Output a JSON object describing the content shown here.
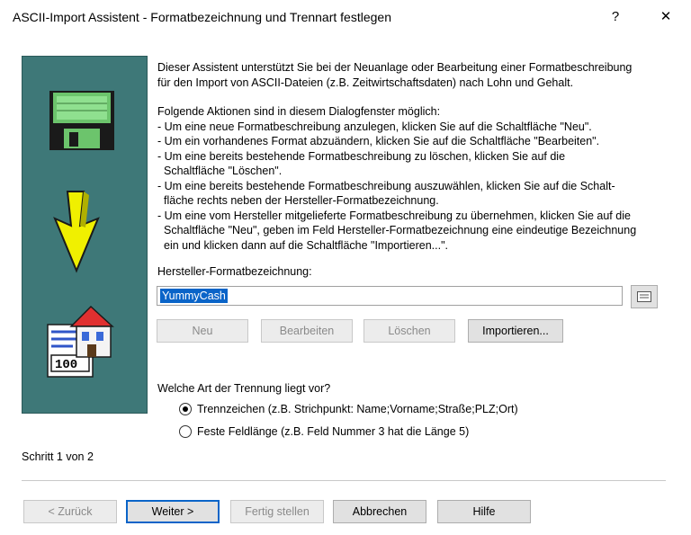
{
  "window": {
    "title": "ASCII-Import Assistent - Formatbezeichnung und Trennart festlegen",
    "help_button": "?",
    "close_button": "✕"
  },
  "description": {
    "intro_lines": [
      "Dieser Assistent unterstützt Sie bei der Neuanlage oder Bearbeitung einer Formatbeschreibung",
      "für den Import von ASCII-Dateien (z.B. Zeitwirtschaftsdaten) nach Lohn und Gehalt."
    ],
    "action_lines": [
      "Folgende Aktionen sind in diesem Dialogfenster möglich:",
      "- Um eine neue Formatbeschreibung anzulegen, klicken Sie auf die Schaltfläche \"Neu\".",
      "- Um ein vorhandenes Format abzuändern, klicken Sie auf die Schaltfläche \"Bearbeiten\".",
      "- Um eine bereits bestehende Formatbeschreibung zu löschen, klicken Sie auf die",
      "  Schaltfläche \"Löschen\".",
      "- Um eine bereits bestehende Formatbeschreibung auszuwählen, klicken Sie auf die Schalt-",
      "  fläche rechts neben der Hersteller-Formatbezeichnung.",
      "- Um eine vom Hersteller mitgelieferte Formatbeschreibung zu übernehmen, klicken Sie auf die",
      "  Schaltfläche \"Neu\", geben im Feld Hersteller-Formatbezeichnung eine eindeutige Bezeichnung",
      "  ein und klicken dann auf die Schaltfläche \"Importieren...\"."
    ]
  },
  "format_field": {
    "label": "Hersteller-Formatbezeichnung:",
    "value": "YummyCash"
  },
  "action_buttons": {
    "neu": "Neu",
    "bearbeiten": "Bearbeiten",
    "loeschen": "Löschen",
    "importieren": "Importieren..."
  },
  "separator_group": {
    "question": "Welche Art der Trennung liegt vor?",
    "option_trennzeichen": "Trennzeichen (z.B. Strichpunkt: Name;Vorname;Straße;PLZ;Ort)",
    "option_feldlaenge": "Feste Feldlänge (z.B. Feld Nummer 3 hat die Länge 5)",
    "selected": "trennzeichen"
  },
  "step_text": "Schritt 1 von 2",
  "illustration": {
    "counter_text": "100"
  },
  "footer": {
    "back": "< Zurück",
    "next": "Weiter >",
    "finish": "Fertig stellen",
    "cancel": "Abbrechen",
    "help": "Hilfe"
  },
  "colors": {
    "side_panel": "#3e7878",
    "accent": "#0a64c8",
    "arrow": "#f0f000",
    "disk": "#6cc46c"
  }
}
